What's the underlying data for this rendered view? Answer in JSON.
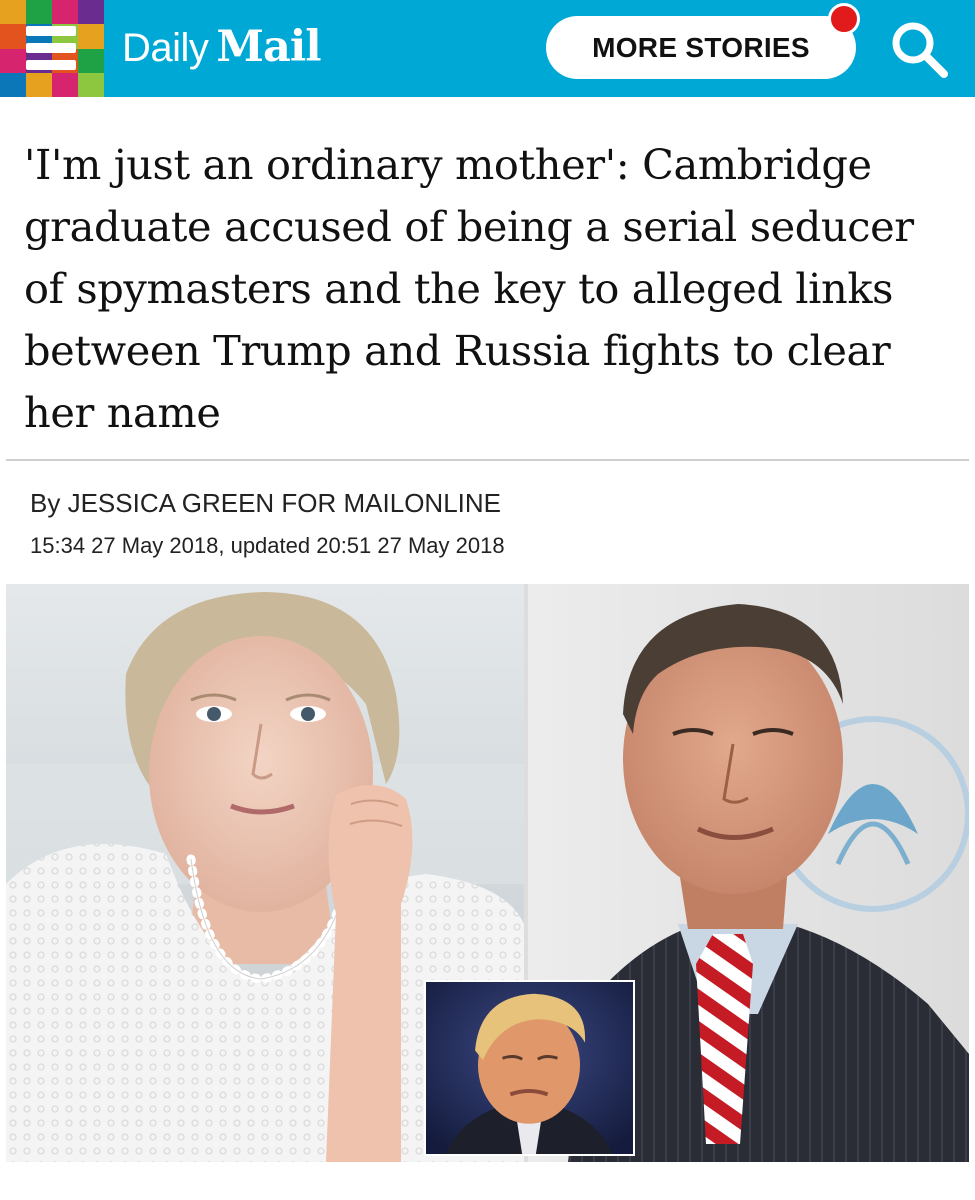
{
  "header": {
    "brand_daily": "Daily",
    "brand_mail": "Mail",
    "more_stories_label": "MORE STORIES",
    "brand_color": "#00a8d6",
    "notification_color": "#e11b1b",
    "menu_icon": "hamburger-menu-icon",
    "search_icon": "search-icon"
  },
  "article": {
    "headline": "'I'm just an ordinary mother': Cambridge graduate accused of being a serial seducer of spymasters and the key to alleged links between Trump and Russia fights to clear her name",
    "byline": "By JESSICA GREEN FOR MAILONLINE",
    "dateline": "15:34 27 May 2018, updated 20:51 27 May 2018"
  }
}
